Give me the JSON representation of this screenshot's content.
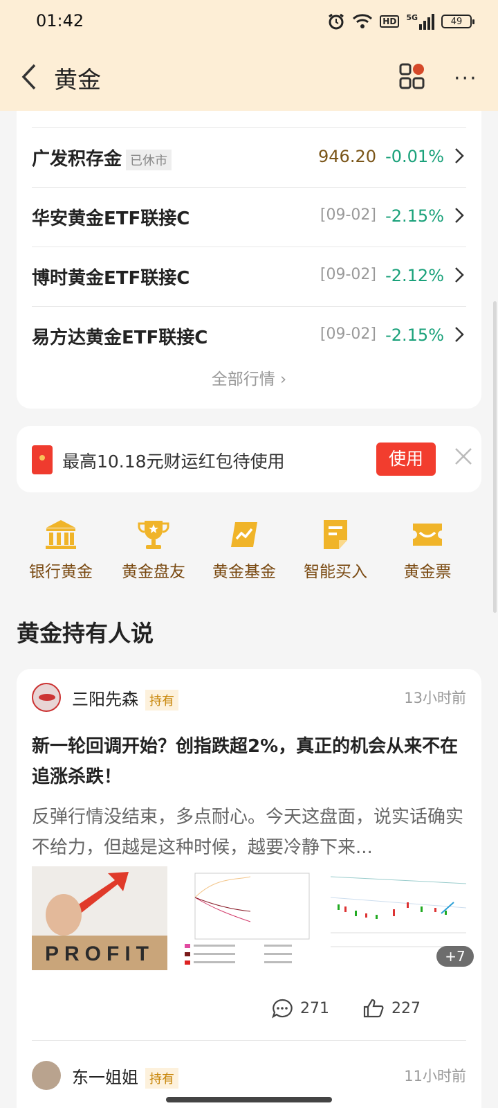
{
  "status": {
    "time": "01:42",
    "battery": "49",
    "hd": "HD",
    "net": "5G"
  },
  "nav": {
    "title": "黄金"
  },
  "funds": [
    {
      "name": "广发积存金",
      "tag": "已休市",
      "value": "946.20",
      "date": "",
      "change": "-0.01%"
    },
    {
      "name": "华安黄金ETF联接C",
      "tag": "",
      "value": "",
      "date": "[09-02]",
      "change": "-2.15%"
    },
    {
      "name": "博时黄金ETF联接C",
      "tag": "",
      "value": "",
      "date": "[09-02]",
      "change": "-2.12%"
    },
    {
      "name": "易方达黄金ETF联接C",
      "tag": "",
      "value": "",
      "date": "[09-02]",
      "change": "-2.15%"
    }
  ],
  "all_link": "全部行情",
  "hongbao": {
    "text": "最高10.18元财运红包待使用",
    "button": "使用"
  },
  "shortcuts": [
    "银行黄金",
    "黄金盘友",
    "黄金基金",
    "智能买入",
    "黄金票"
  ],
  "section_title": "黄金持有人说",
  "post": {
    "author": "三阳先森",
    "hold_tag": "持有",
    "time": "13小时前",
    "title": "新一轮回调开始？创指跌超2%，真正的机会从来不在追涨杀跌！",
    "body": "反弹行情没结束，多点耐心。今天这盘面，说实话确实不给力，但越是这种时候，越要冷静下来...",
    "image_text": "PROFIT",
    "more_images": "+7",
    "comments": "271",
    "likes": "227"
  },
  "post2": {
    "author": "东一姐姐",
    "hold_tag": "持有",
    "time": "11小时前"
  },
  "colors": {
    "down": "#1aa17a",
    "accent": "#f23d2e",
    "gold": "#f0b429",
    "topbar": "#fdeed6"
  }
}
